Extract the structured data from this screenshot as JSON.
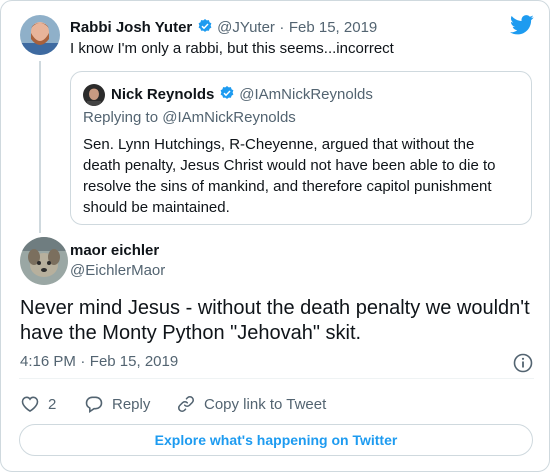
{
  "reply_tweet": {
    "author_name": "Rabbi Josh Yuter",
    "author_handle": "@JYuter",
    "separator": "·",
    "date": "Feb 15, 2019",
    "text": "I know I'm only a rabbi, but this seems...incorrect",
    "avatar_icon": "bearded-man-avatar"
  },
  "quoted_tweet": {
    "author_name": "Nick Reynolds",
    "author_handle": "@IAmNickReynolds",
    "replying_to": "Replying to @IAmNickReynolds",
    "text": "Sen. Lynn Hutchings, R-Cheyenne, argued that without the death penalty, Jesus Christ would not have been able to die to resolve the sins of mankind, and therefore capitol punishment should be maintained."
  },
  "main_tweet": {
    "author_name": "maor eichler",
    "author_handle": "@EichlerMaor",
    "text": "Never mind Jesus - without the death penalty we wouldn't have the Monty Python \"Jehovah\" skit.",
    "time": "4:16 PM",
    "separator": "·",
    "date": "Feb 15, 2019"
  },
  "actions": {
    "like_count": "2",
    "reply_label": "Reply",
    "copy_link_label": "Copy link to Tweet"
  },
  "footer": {
    "explore_label": "Explore what's happening on Twitter"
  },
  "colors": {
    "brand": "#1d9bf0",
    "text": "#0f1419",
    "secondary": "#536471",
    "border": "#cfd9de"
  }
}
